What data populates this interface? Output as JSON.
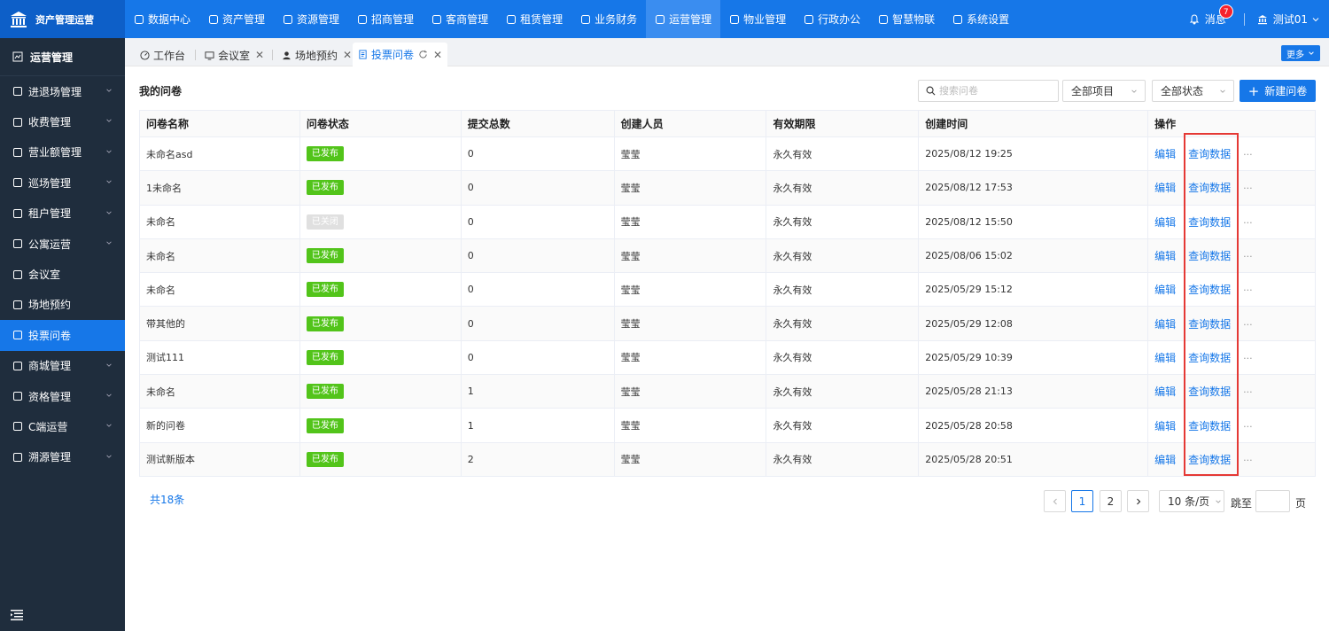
{
  "brand": {
    "title": "资产管理运营"
  },
  "topnav": [
    {
      "label": "数据中心",
      "icon": "dashboard-icon"
    },
    {
      "label": "资产管理",
      "icon": "cube-icon"
    },
    {
      "label": "资源管理",
      "icon": "building-icon"
    },
    {
      "label": "招商管理",
      "icon": "tag-icon"
    },
    {
      "label": "客商管理",
      "icon": "people-icon"
    },
    {
      "label": "租赁管理",
      "icon": "house-icon"
    },
    {
      "label": "业务财务",
      "icon": "money-icon"
    },
    {
      "label": "运营管理",
      "icon": "ops-icon",
      "active": true
    },
    {
      "label": "物业管理",
      "icon": "home-icon"
    },
    {
      "label": "行政办公",
      "icon": "monitor-icon"
    },
    {
      "label": "智慧物联",
      "icon": "iot-icon"
    },
    {
      "label": "系统设置",
      "icon": "gear-icon"
    }
  ],
  "user": {
    "messages_label": "消息",
    "messages_count": "7",
    "username": "测试01"
  },
  "sidebar": {
    "title": "运营管理",
    "items": [
      {
        "label": "进退场管理",
        "icon": "door-icon",
        "expandable": true
      },
      {
        "label": "收费管理",
        "icon": "wallet-icon",
        "expandable": true
      },
      {
        "label": "营业额管理",
        "icon": "dollar-icon",
        "expandable": true
      },
      {
        "label": "巡场管理",
        "icon": "map-icon",
        "expandable": true
      },
      {
        "label": "租户管理",
        "icon": "user-icon",
        "expandable": true
      },
      {
        "label": "公寓运营",
        "icon": "apartment-icon",
        "expandable": true
      },
      {
        "label": "会议室",
        "icon": "meeting-icon",
        "expandable": false
      },
      {
        "label": "场地预约",
        "icon": "person-icon",
        "expandable": false
      },
      {
        "label": "投票问卷",
        "icon": "survey-icon",
        "expandable": false,
        "active": true
      },
      {
        "label": "商城管理",
        "icon": "shop-icon",
        "expandable": true
      },
      {
        "label": "资格管理",
        "icon": "badge-icon",
        "expandable": true
      },
      {
        "label": "C端运营",
        "icon": "target-icon",
        "expandable": true
      },
      {
        "label": "溯源管理",
        "icon": "trace-icon",
        "expandable": true
      }
    ]
  },
  "tabs": [
    {
      "label": "工作台",
      "closable": false
    },
    {
      "label": "会议室",
      "closable": true
    },
    {
      "label": "场地预约",
      "closable": true
    },
    {
      "label": "投票问卷",
      "closable": true,
      "active": true
    }
  ],
  "more_label": "更多",
  "page": {
    "title": "我的问卷",
    "search_placeholder": "搜索问卷",
    "filter_project": "全部项目",
    "filter_status": "全部状态",
    "new_button": "新建问卷"
  },
  "table": {
    "headers": [
      "问卷名称",
      "问卷状态",
      "提交总数",
      "创建人员",
      "有效期限",
      "创建时间",
      "操作"
    ],
    "rows": [
      {
        "name": "未命名asd",
        "status": "已发布",
        "closed": false,
        "count": "0",
        "creator": "莹莹",
        "validity": "永久有效",
        "created": "2025/08/12 19:25"
      },
      {
        "name": "1未命名",
        "status": "已发布",
        "closed": false,
        "count": "0",
        "creator": "莹莹",
        "validity": "永久有效",
        "created": "2025/08/12 17:53"
      },
      {
        "name": "未命名",
        "status": "已关闭",
        "closed": true,
        "count": "0",
        "creator": "莹莹",
        "validity": "永久有效",
        "created": "2025/08/12 15:50"
      },
      {
        "name": "未命名",
        "status": "已发布",
        "closed": false,
        "count": "0",
        "creator": "莹莹",
        "validity": "永久有效",
        "created": "2025/08/06 15:02"
      },
      {
        "name": "未命名",
        "status": "已发布",
        "closed": false,
        "count": "0",
        "creator": "莹莹",
        "validity": "永久有效",
        "created": "2025/05/29 15:12"
      },
      {
        "name": "带其他的",
        "status": "已发布",
        "closed": false,
        "count": "0",
        "creator": "莹莹",
        "validity": "永久有效",
        "created": "2025/05/29 12:08"
      },
      {
        "name": "测试111",
        "status": "已发布",
        "closed": false,
        "count": "0",
        "creator": "莹莹",
        "validity": "永久有效",
        "created": "2025/05/29 10:39"
      },
      {
        "name": "未命名",
        "status": "已发布",
        "closed": false,
        "count": "1",
        "creator": "莹莹",
        "validity": "永久有效",
        "created": "2025/05/28 21:13"
      },
      {
        "name": "新的问卷",
        "status": "已发布",
        "closed": false,
        "count": "1",
        "creator": "莹莹",
        "validity": "永久有效",
        "created": "2025/05/28 20:58"
      },
      {
        "name": "测试新版本",
        "status": "已发布",
        "closed": false,
        "count": "2",
        "creator": "莹莹",
        "validity": "永久有效",
        "created": "2025/05/28 20:51"
      }
    ],
    "op_edit": "编辑",
    "op_query": "查询数据",
    "op_more": "···"
  },
  "pagination": {
    "total": "共18条",
    "pages": [
      "1",
      "2"
    ],
    "current": "1",
    "page_size": "10 条/页",
    "jump_label": "跳至",
    "page_unit": "页"
  },
  "colors": {
    "primary": "#1677e8",
    "sidebar": "#1f2d3d",
    "published": "#52c41a",
    "highlight": "#e53935"
  }
}
